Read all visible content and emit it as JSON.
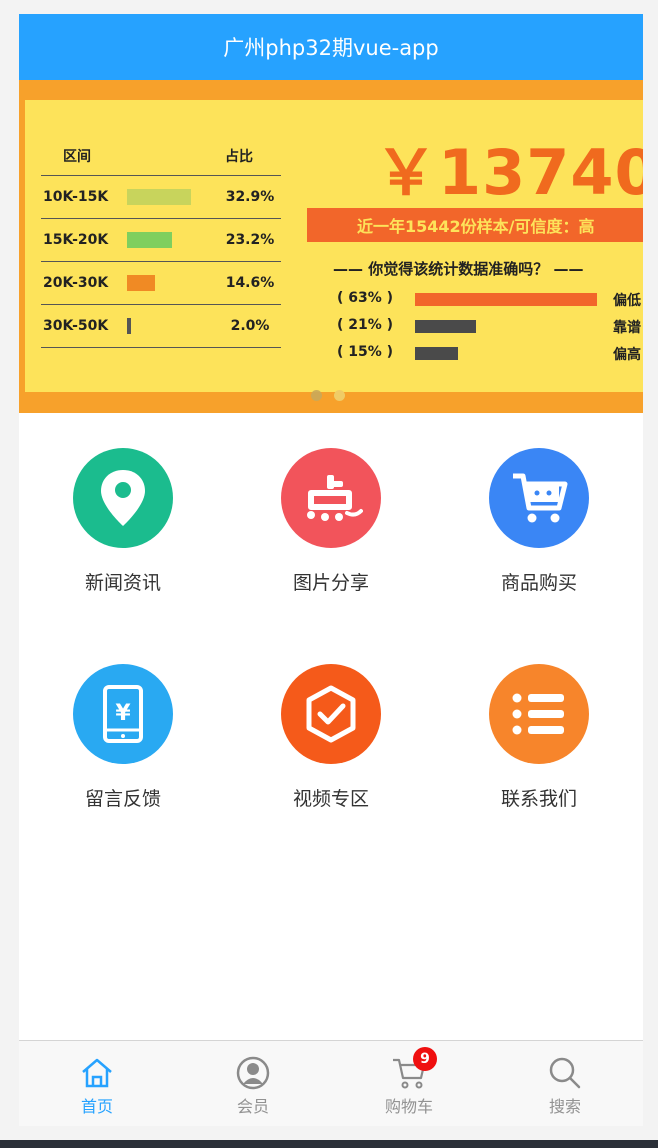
{
  "header": {
    "title": "广州php32期vue-app"
  },
  "banner": {
    "table_headers": [
      "区间",
      "占比"
    ],
    "table_rows": [
      {
        "range": "10K-15K",
        "percent": "32.9%",
        "share": 0.329,
        "color": "#c8d45c"
      },
      {
        "range": "15K-20K",
        "percent": "23.2%",
        "share": 0.232,
        "color": "#7fcf5e"
      },
      {
        "range": "20K-30K",
        "percent": "14.6%",
        "share": 0.146,
        "color": "#f08a24"
      },
      {
        "range": "30K-50K",
        "percent": "2.0%",
        "share": 0.02,
        "color": "#555555"
      }
    ],
    "salary": "￥13740",
    "sample_text": "近一年15442份样本/可信度：高",
    "question": "—— 你觉得该统计数据准确吗？ ——",
    "votes": [
      {
        "percent": "( 63% )",
        "share": 0.63,
        "label": "偏低",
        "color": "#f2662a"
      },
      {
        "percent": "( 21% )",
        "share": 0.21,
        "label": "靠谱",
        "color": "#4a4a4a"
      },
      {
        "percent": "( 15% )",
        "share": 0.15,
        "label": "偏高",
        "color": "#4a4a4a"
      }
    ],
    "slide_count": 2,
    "active_slide": 1
  },
  "grid": [
    {
      "label": "新闻资讯",
      "icon": "location-pin-icon",
      "color": "#1bbc8e"
    },
    {
      "label": "图片分享",
      "icon": "dianping-icon",
      "color": "#f2545b"
    },
    {
      "label": "商品购买",
      "icon": "shopping-cart-icon",
      "color": "#3a86f5"
    },
    {
      "label": "留言反馈",
      "icon": "phone-yen-icon",
      "color": "#29a9f2"
    },
    {
      "label": "视频专区",
      "icon": "check-hexagon-icon",
      "color": "#f55a1a"
    },
    {
      "label": "联系我们",
      "icon": "list-icon",
      "color": "#f7852b"
    }
  ],
  "tabs": [
    {
      "label": "首页",
      "icon": "home-icon",
      "active": true
    },
    {
      "label": "会员",
      "icon": "user-icon",
      "active": false
    },
    {
      "label": "购物车",
      "icon": "cart-icon",
      "active": false,
      "badge": "9"
    },
    {
      "label": "搜索",
      "icon": "search-icon",
      "active": false
    }
  ],
  "colors": {
    "accent": "#26a2ff",
    "badge": "#ef0f0f"
  }
}
